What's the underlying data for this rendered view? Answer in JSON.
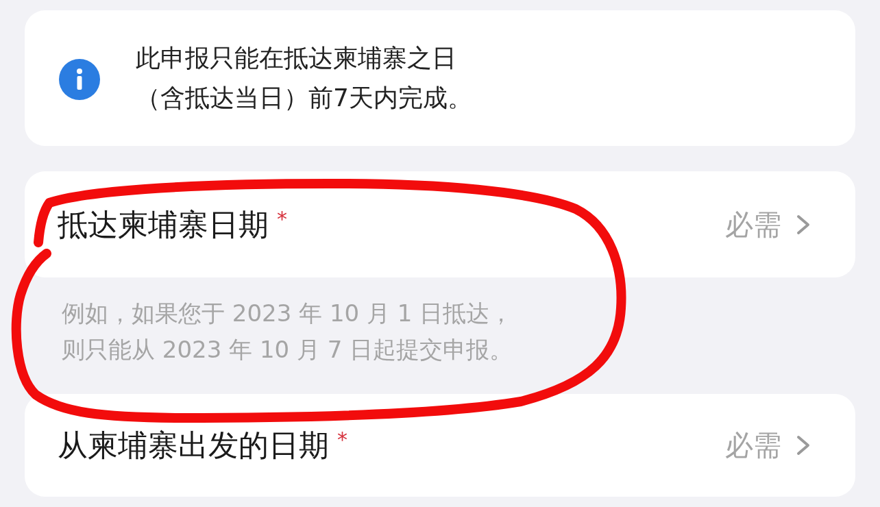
{
  "notice": {
    "lines": [
      "此申报只能在抵达柬埔寨之日",
      "（含抵达当日）前7天内完成。"
    ]
  },
  "fields": [
    {
      "label": "抵达柬埔寨日期",
      "required_mark": "*",
      "placeholder": "必需",
      "hint": [
        "例如，如果您于 2023 年 10 月 1 日抵达，",
        "则只能从 2023 年 10 月 7 日起提交申报。"
      ]
    },
    {
      "label": "从柬埔寨出发的日期",
      "required_mark": "*",
      "placeholder": "必需"
    }
  ]
}
